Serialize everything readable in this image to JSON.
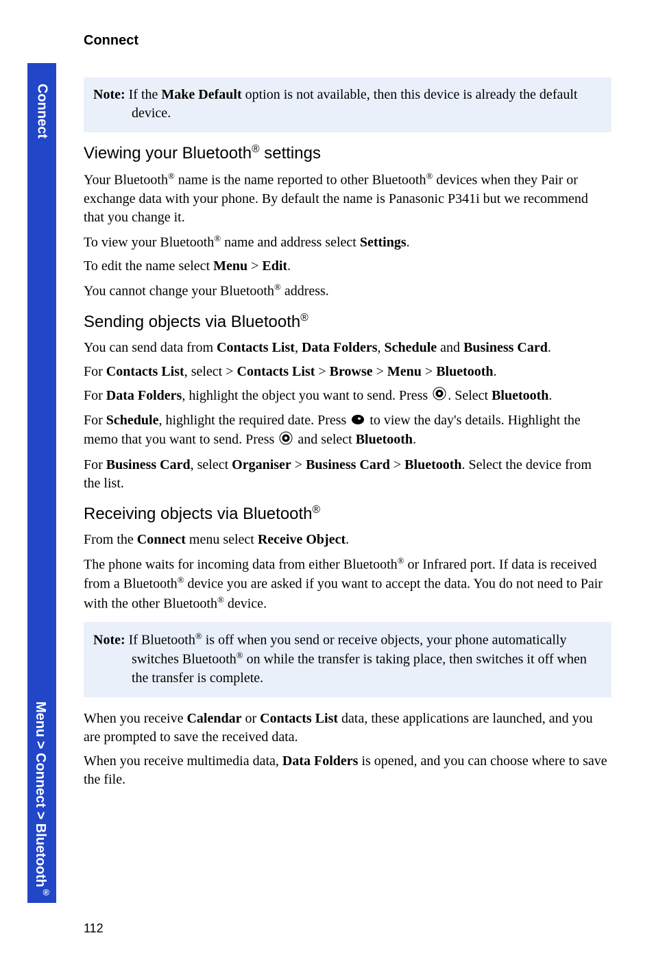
{
  "sidebar": {
    "top_tab": "Connect",
    "bottom_tab": "Menu > Connect > Bluetooth"
  },
  "header": {
    "section": "Connect"
  },
  "note1": {
    "label": "Note:",
    "line1": " If the ",
    "bold1": "Make Default",
    "line2": " option is not available, then this device is already the default",
    "line3": "device."
  },
  "h1": {
    "pre": "Viewing your Bluetooth",
    "sup": "®",
    "post": " settings"
  },
  "p1": {
    "t1": "Your Bluetooth",
    "sup1": "®",
    "t2": " name is the name reported to other Bluetooth",
    "sup2": "®",
    "t3": " devices when they Pair or exchange data with your phone. By default the name is Panasonic P341i but we recommend that you change it."
  },
  "p2": {
    "t1": "To view your Bluetooth",
    "sup": "®",
    "t2": " name and address select ",
    "b1": "Settings",
    "t3": "."
  },
  "p3": {
    "t1": "To edit the name select ",
    "b1": "Menu",
    "t2": " > ",
    "b2": "Edit",
    "t3": "."
  },
  "p4": {
    "t1": "You cannot change your Bluetooth",
    "sup": "®",
    "t2": " address."
  },
  "h2": {
    "pre": "Sending objects via Bluetooth",
    "sup": "®"
  },
  "p5": {
    "t1": "You can send data from ",
    "b1": "Contacts List",
    "t2": ", ",
    "b2": "Data Folders",
    "t3": ", ",
    "b3": "Schedule",
    "t4": " and ",
    "b4": "Business Card",
    "t5": "."
  },
  "p6": {
    "t1": "For ",
    "b1": "Contacts List",
    "t2": ", select > ",
    "b2": "Contacts List",
    "t3": " > ",
    "b3": "Browse",
    "t4": " > ",
    "b4": "Menu",
    "t5": " > ",
    "b5": "Bluetooth",
    "t6": "."
  },
  "p7": {
    "t1": "For ",
    "b1": "Data Folders",
    "t2": ", highlight the object you want to send. Press ",
    "t3": ". Select ",
    "b2": "Bluetooth",
    "t4": "."
  },
  "p8": {
    "t1": "For ",
    "b1": "Schedule",
    "t2": ", highlight the required date. Press ",
    "t3": " to view the day's details. Highlight the memo that you want to send. Press ",
    "t4": " and select ",
    "b2": "Bluetooth",
    "t5": "."
  },
  "p9": {
    "t1": "For ",
    "b1": "Business Card",
    "t2": ", select ",
    "b2": "Organiser",
    "t3": " > ",
    "b3": "Business Card",
    "t4": " > ",
    "b4": "Bluetooth",
    "t5": ". Select the device from the list."
  },
  "h3": {
    "pre": "Receiving objects via Bluetooth",
    "sup": "®"
  },
  "p10": {
    "t1": "From the ",
    "b1": "Connect",
    "t2": " menu select ",
    "b2": "Receive Object",
    "t3": "."
  },
  "p11": {
    "t1": "The phone waits for incoming data from either Bluetooth",
    "sup1": "®",
    "t2": " or Infrared port. If data is received from a Bluetooth",
    "sup2": "®",
    "t3": " device you are asked if you want to accept the data. You do not need to Pair with the other Bluetooth",
    "sup3": "®",
    "t4": " device."
  },
  "note2": {
    "label": "Note:",
    "t1": " If Bluetooth",
    "sup1": "®",
    "t2": " is off when you send or receive objects, your phone automatically",
    "t3": "switches Bluetooth",
    "sup2": "®",
    "t4": " on while the transfer is taking place, then switches it off when the transfer is complete."
  },
  "p12": {
    "t1": "When you receive ",
    "b1": "Calendar",
    "t2": " or ",
    "b2": "Contacts List",
    "t3": " data, these applications are launched, and you are prompted to save the received data."
  },
  "p13": {
    "t1": "When you receive multimedia data, ",
    "b1": "Data Folders",
    "t2": " is opened, and you can choose where to save the file."
  },
  "page_number": "112"
}
